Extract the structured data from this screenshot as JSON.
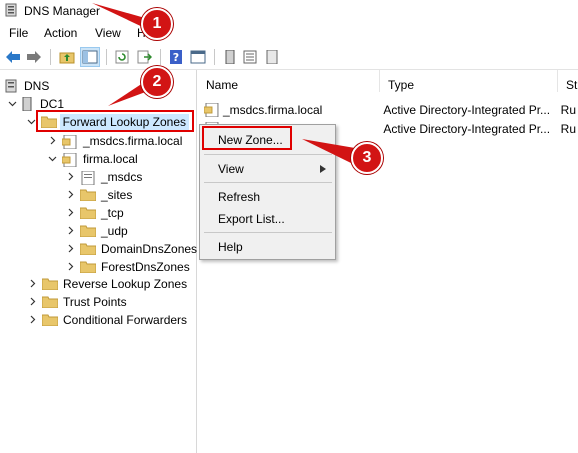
{
  "window": {
    "title": "DNS Manager"
  },
  "menu": [
    "File",
    "Action",
    "View",
    "Help"
  ],
  "tree": {
    "root": "DNS",
    "server": "DC1",
    "forward_zones": "Forward Lookup Zones",
    "zone_msdcs": "_msdcs.firma.local",
    "zone_firma": "firma.local",
    "children": [
      "_msdcs",
      "_sites",
      "_tcp",
      "_udp",
      "DomainDnsZones",
      "ForestDnsZones"
    ],
    "reverse_zones": "Reverse Lookup Zones",
    "trust_points": "Trust Points",
    "conditional_forwarders": "Conditional Forwarders"
  },
  "list": {
    "columns": [
      "Name",
      "Type",
      "St"
    ],
    "rows": [
      {
        "name": "_msdcs.firma.local",
        "type": "Active Directory-Integrated Pr...",
        "status": "Ru"
      },
      {
        "name": "",
        "type": "Active Directory-Integrated Pr...",
        "status": "Ru"
      }
    ]
  },
  "context_menu": {
    "new_zone": "New Zone...",
    "view": "View",
    "refresh": "Refresh",
    "export": "Export List...",
    "help": "Help"
  },
  "callouts": [
    "1",
    "2",
    "3"
  ],
  "colors": {
    "callout": "#d21414",
    "highlight_box": "#e00000",
    "folder": "#e8c66a"
  }
}
